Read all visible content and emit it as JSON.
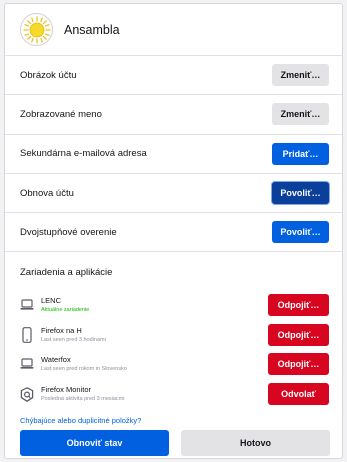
{
  "account": {
    "name": "Ansambla"
  },
  "settings": [
    {
      "id": "avatar",
      "label": "Obrázok účtu",
      "button": "Zmeniť…",
      "style": "gray"
    },
    {
      "id": "display-name",
      "label": "Zobrazované meno",
      "button": "Zmeniť…",
      "style": "gray"
    },
    {
      "id": "secondary-email",
      "label": "Sekundárna e-mailová adresa",
      "button": "Pridať…",
      "style": "blue"
    },
    {
      "id": "recovery",
      "label": "Obnova účtu",
      "button": "Povoliť…",
      "style": "darkblue"
    },
    {
      "id": "two-step",
      "label": "Dvojstupňové overenie",
      "button": "Povoliť…",
      "style": "blue"
    }
  ],
  "devices_section": {
    "title": "Zariadenia a aplikácie",
    "items": [
      {
        "name": "LENC",
        "sub": "Aktuálne zariadenie",
        "icon": "laptop-icon",
        "button": "Odpojiť…",
        "current": true
      },
      {
        "name": "Firefox na H",
        "sub": "Last seen pred 3 hodinami",
        "icon": "phone-icon",
        "button": "Odpojiť…",
        "current": false
      },
      {
        "name": "Waterfox",
        "sub": "Last seen pred rokom in Slovensko",
        "icon": "laptop-icon",
        "button": "Odpojiť…",
        "current": false
      },
      {
        "name": "Firefox Monitor",
        "sub": "Posledná aktivita pred 3 mesiacmi",
        "icon": "monitor-shield-icon",
        "button": "Odvolať",
        "current": false
      }
    ],
    "missing_link": "Chýbajúce alebo duplicitné položky?"
  },
  "footer": {
    "refresh": "Obnoviť stav",
    "done": "Hotovo"
  },
  "colors": {
    "primary": "#0060df",
    "danger": "#d7051f",
    "current_device": "#12bc00"
  }
}
